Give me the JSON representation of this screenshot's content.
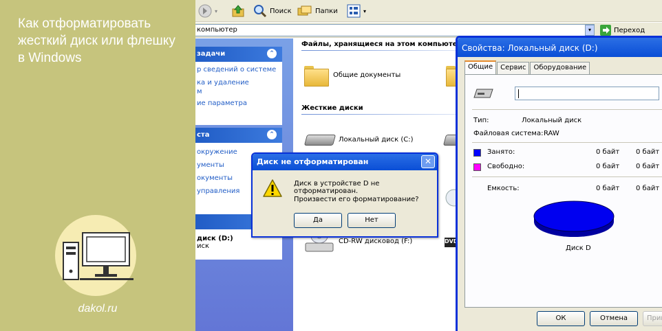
{
  "panel": {
    "title": "Как отформатировать жесткий диск или флешку в Windows",
    "site": "dakol.ru"
  },
  "explorer": {
    "toolbar": {
      "search_label": "Поиск",
      "folders_label": "Папки"
    },
    "address": {
      "value": "компьютер",
      "go_label": "Переход"
    },
    "taskpane": {
      "groups": [
        {
          "title": "задачи",
          "links": [
            "р сведений о системе",
            "ка и удаление",
            "м",
            "ие параметра"
          ]
        },
        {
          "title": "ста",
          "links": [
            "окружение",
            "ументы",
            "окументы",
            "управления"
          ]
        },
        {
          "title": "",
          "links": []
        }
      ],
      "details_title": "диск (D:)",
      "details_sub": "иск"
    },
    "content": {
      "section_files": "Файлы, хранящиеся на этом компьютер",
      "shared_docs": "Общие документы",
      "section_hdd": "Жесткие диски",
      "local_c": "Локальный диск (C:)",
      "cdrw": "CD-RW дисковод (F:)",
      "dvd_badge": "DVD"
    }
  },
  "nf_dialog": {
    "title": "Диск не отформатирован",
    "line1": "Диск в устройстве D не отформатирован.",
    "line2": "Произвести его форматирование?",
    "yes_label": "Да",
    "no_label": "Нет",
    "close_glyph": "✕"
  },
  "props": {
    "title": "Свойства: Локальный диск (D:)",
    "tabs": [
      "Общие",
      "Сервис",
      "Оборудование"
    ],
    "name_value": "",
    "type_label": "Тип:",
    "type_value": "Локальный диск",
    "fs_label": "Файловая система:",
    "fs_value": "RAW",
    "used_label": "Занято:",
    "used_bytes": "0 байт",
    "used_short": "0 байт",
    "free_label": "Свободно:",
    "free_bytes": "0 байт",
    "free_short": "0 байт",
    "cap_label": "Емкость:",
    "cap_bytes": "0 байт",
    "cap_short": "0 байт",
    "disk_label": "Диск D",
    "ok_label": "ОК",
    "cancel_label": "Отмена",
    "apply_label": "Прим",
    "colors": {
      "used": "#0000ff",
      "free": "#ff00ff",
      "pie": "#0000f0"
    }
  }
}
